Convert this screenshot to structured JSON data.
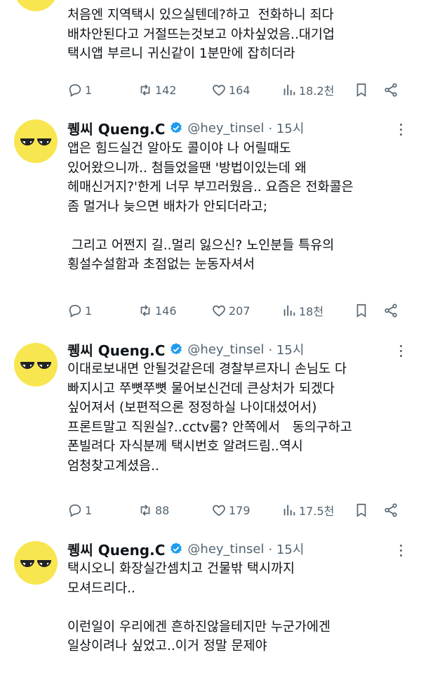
{
  "tweets": [
    {
      "lines": [
        "처음엔 지역택시 있으실텐데?하고  전화하니 죄다",
        "배차안된다고 거절뜨는것보고 아차싶었음..대기업",
        "택시앱 부르니 귀신같이 1분만에 잡히더라"
      ],
      "replies": "1",
      "retweets": "142",
      "likes": "164",
      "views": "18.2천"
    },
    {
      "name": "퀭씨 Queng.C",
      "handle": "@hey_tinsel",
      "time": "· 15시",
      "lines": [
        "앱은 힘드실건 알아도 콜이야 나 어릴때도",
        "있어왔으니까.. 첨들었을땐 '방법이있는데 왜",
        "헤매신거지?'한게 너무 부끄러웠음.. 요즘은 전화콜은",
        "좀 멀거나 늦으면 배차가 안되더라고;",
        "",
        " 그리고 어쩐지 길..멀리 잃으신? 노인분들 특유의",
        "횡설수설함과 초점없는 눈동자셔서"
      ],
      "replies": "1",
      "retweets": "146",
      "likes": "207",
      "views": "18천"
    },
    {
      "name": "퀭씨 Queng.C",
      "handle": "@hey_tinsel",
      "time": "· 15시",
      "lines": [
        "이대로보내면 안될것같은데 경찰부르자니 손님도 다",
        "빠지시고 쭈뼛쭈뼛 물어보신건데 큰상처가 되겠다",
        "싶어져서 (보편적으론 정정하실 나이대셨어서)",
        "프론트말고 직원실?..cctv룸? 안쪽에서   동의구하고",
        "폰빌려다 자식분께 택시번호 알려드림..역시",
        "엄청찾고계셨음.."
      ],
      "replies": "1",
      "retweets": "88",
      "likes": "179",
      "views": "17.5천"
    },
    {
      "name": "퀭씨 Queng.C",
      "handle": "@hey_tinsel",
      "time": "· 15시",
      "lines": [
        "택시오니 화장실간셈치고 건물밖 택시까지",
        "모셔드리다..",
        "",
        "이런일이 우리에겐 흔하진않을테지만 누군가에겐",
        "일상이려나 싶었고..이거 정말 문제야"
      ]
    }
  ],
  "colors": {
    "text": "#0f1419",
    "muted": "#536471",
    "verified": "#1d9bf0",
    "avatar": "#f7e64f"
  }
}
